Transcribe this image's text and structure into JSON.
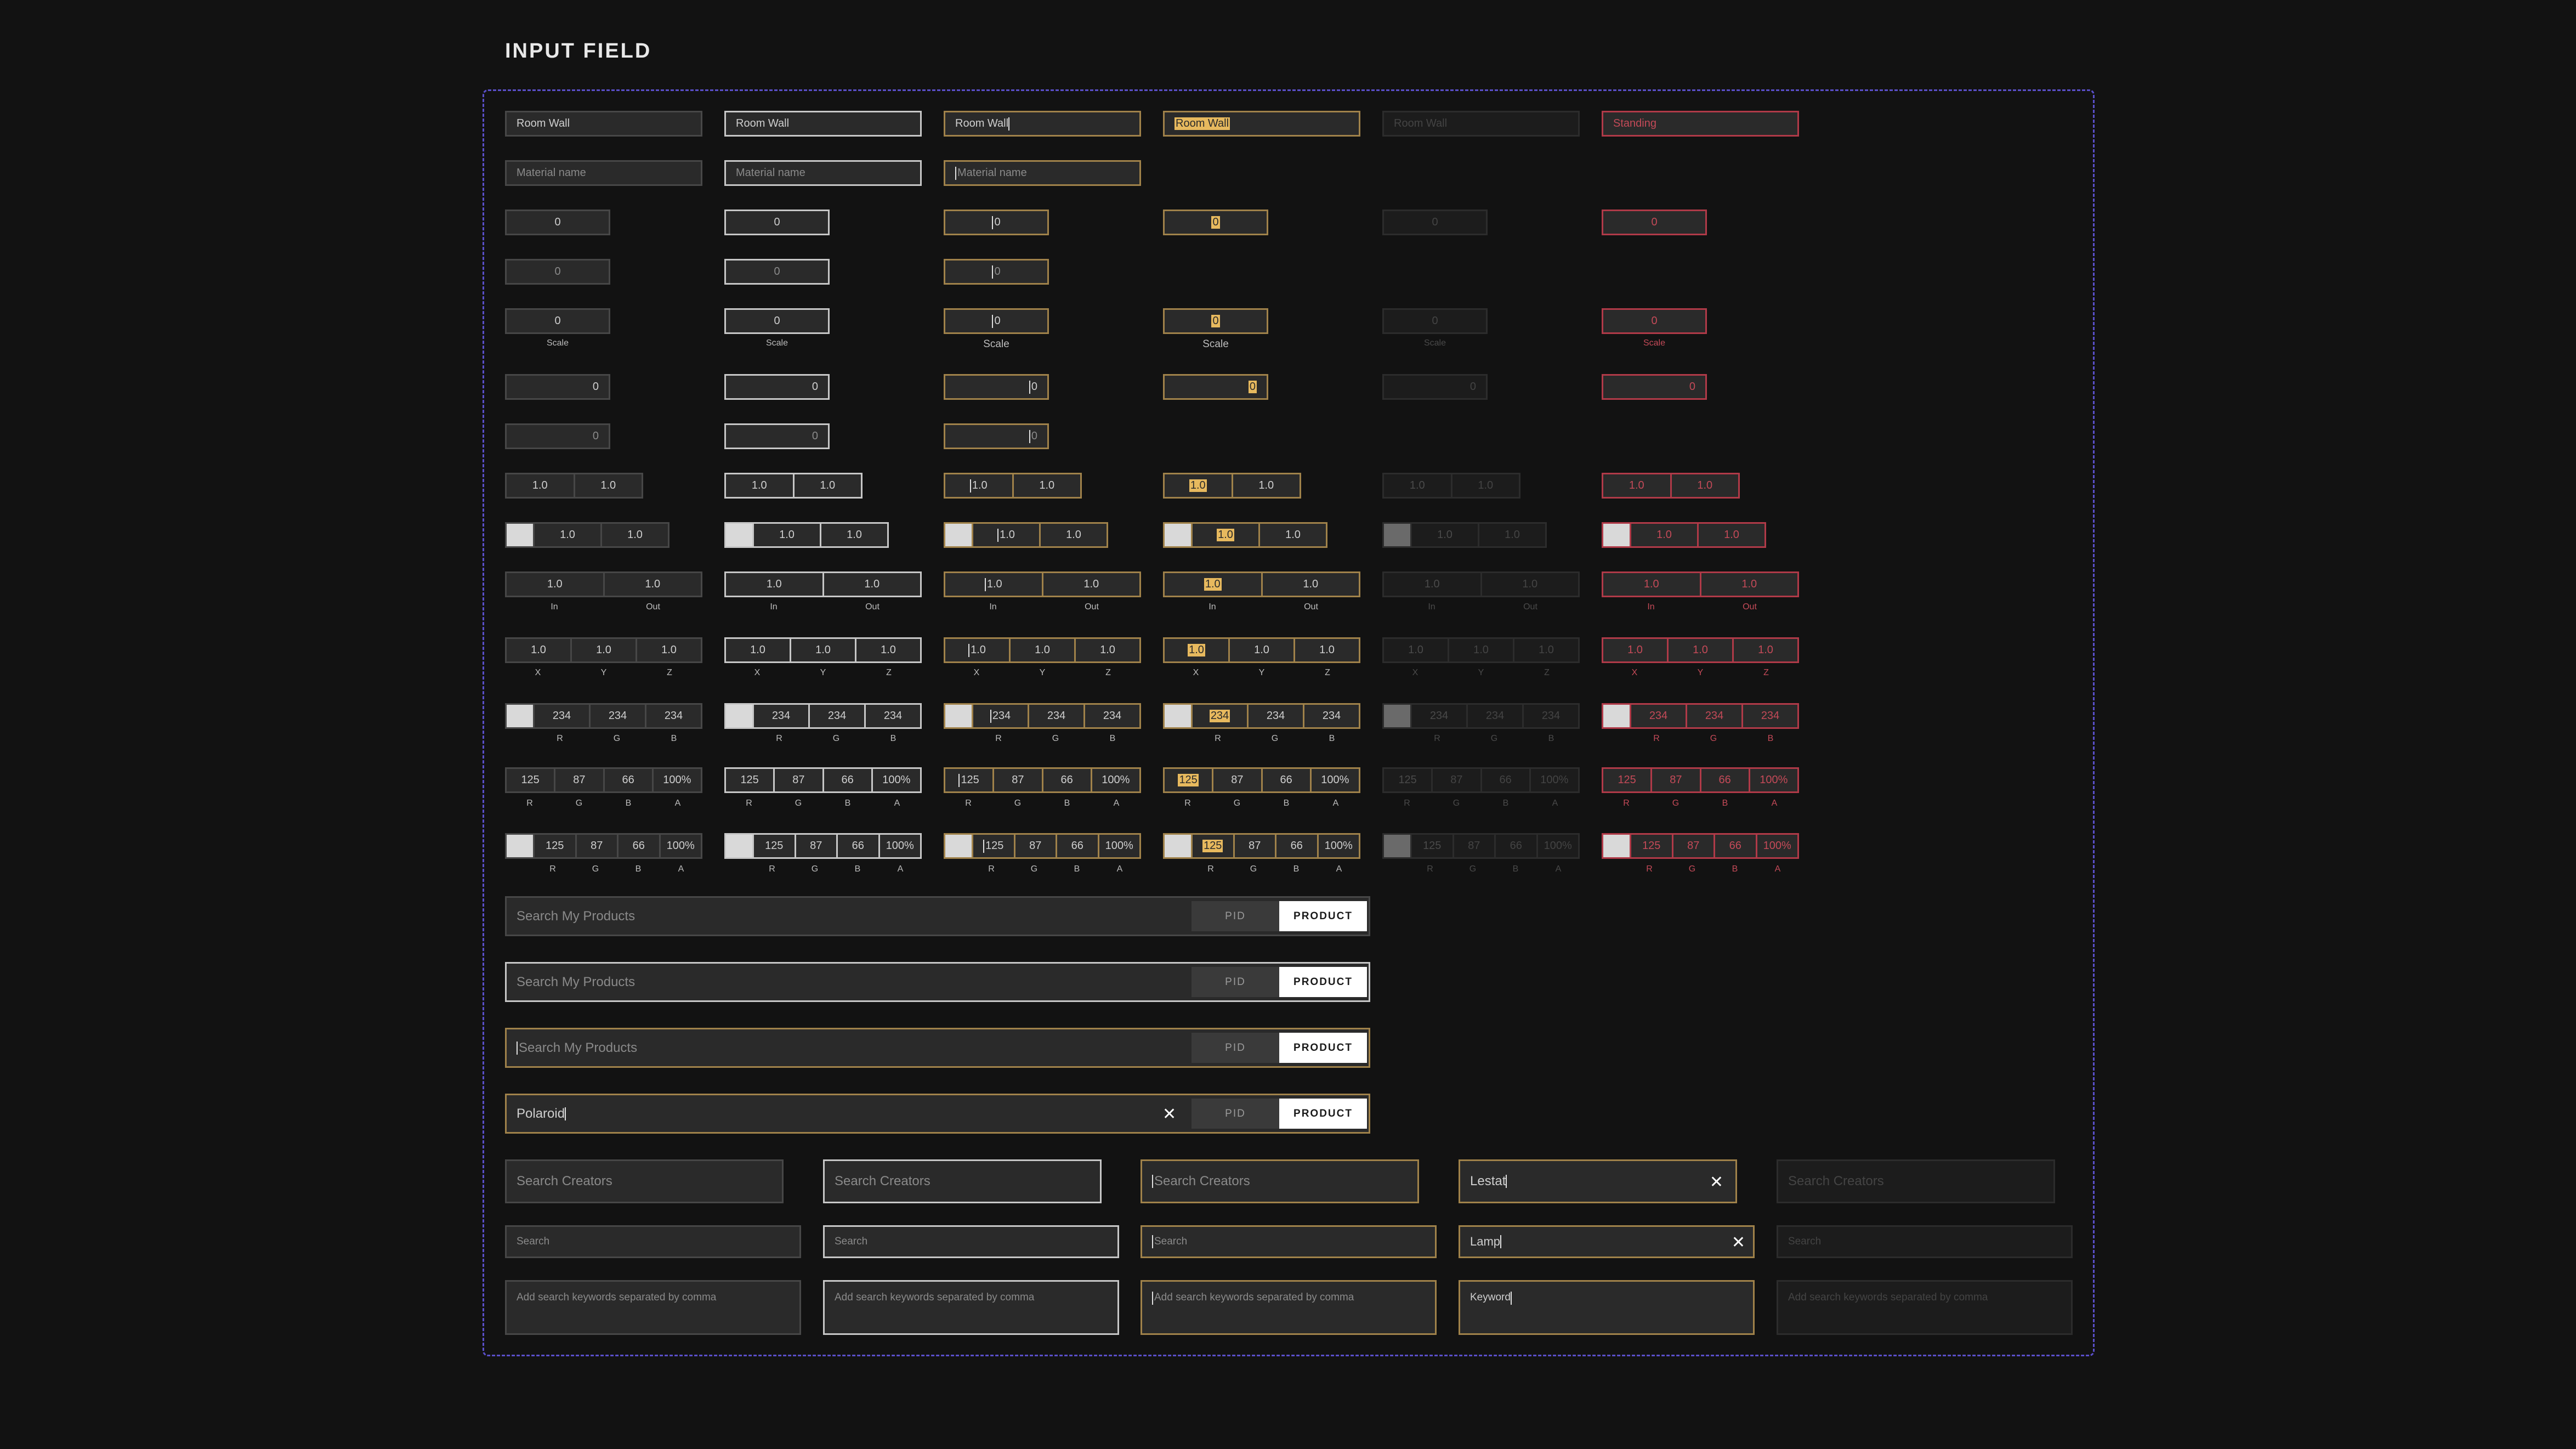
{
  "title": "INPUT FIELD",
  "text_field": {
    "value": "Room Wall",
    "disabled": "Room Wall",
    "error": "Standing",
    "placeholder": "Material name"
  },
  "number": {
    "value": "0",
    "caption": "Scale"
  },
  "pair": {
    "a": "1.0",
    "b": "1.0",
    "in": "In",
    "out": "Out"
  },
  "xyz": {
    "v": "1.0",
    "x": "X",
    "y": "Y",
    "z": "Z"
  },
  "rgb": {
    "r": "234",
    "g": "234",
    "b": "234",
    "lr": "R",
    "lg": "G",
    "lb": "B"
  },
  "rgba": {
    "r": "125",
    "g": "87",
    "b": "66",
    "a": "100%",
    "lr": "R",
    "lg": "G",
    "lb": "B",
    "la": "A"
  },
  "product_search": {
    "placeholder": "Search My Products",
    "value": "Polaroid",
    "pid": "PID",
    "product": "PRODUCT"
  },
  "creators": {
    "placeholder": "Search Creators",
    "value": "Lestat"
  },
  "search": {
    "placeholder": "Search",
    "value": "Lamp"
  },
  "keywords": {
    "placeholder": "Add search keywords separated by comma",
    "value": "Keyword"
  },
  "icons": {
    "clear": "close-icon"
  }
}
